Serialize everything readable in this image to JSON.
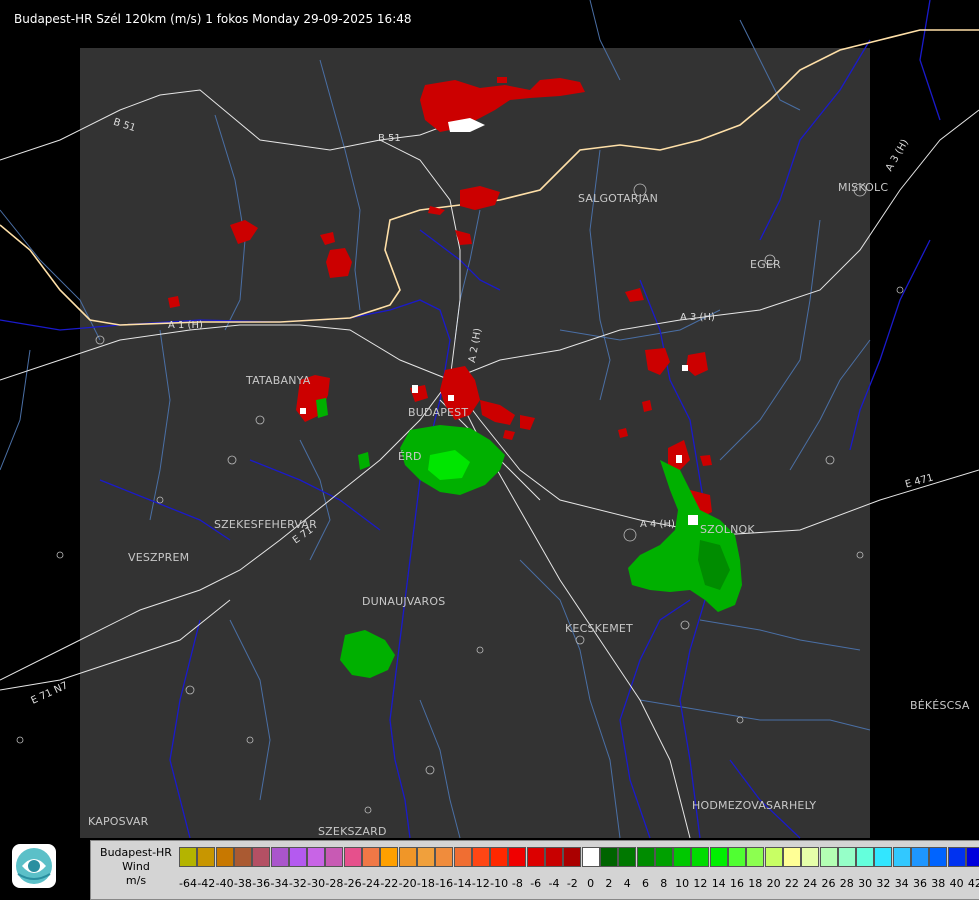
{
  "header": {
    "title": "Budapest-HR Szél 120km (m/s) 1 fokos Monday 29-09-2025 16:48"
  },
  "cities": [
    {
      "id": "salgotarjan",
      "name": "SALGOTARJAN"
    },
    {
      "id": "eger",
      "name": "EGER"
    },
    {
      "id": "miskolc",
      "name": "MISKOLC"
    },
    {
      "id": "tatabanya",
      "name": "TATABANYA"
    },
    {
      "id": "budapest",
      "name": "BUDAPEST"
    },
    {
      "id": "ero",
      "name": "ÉRD"
    },
    {
      "id": "szekesfehervar",
      "name": "SZEKESFEHERVAR"
    },
    {
      "id": "veszprem",
      "name": "VESZPREM"
    },
    {
      "id": "dunaujvaros",
      "name": "DUNAUJVAROS"
    },
    {
      "id": "kecskemet",
      "name": "KECSKEMET"
    },
    {
      "id": "szolnok",
      "name": "SZOLNOK"
    },
    {
      "id": "bekescsaba",
      "name": "BÉKÉSCSA"
    },
    {
      "id": "hodmezovasarhely",
      "name": "HODMEZOVASARHELY"
    },
    {
      "id": "kaposvar",
      "name": "KAPOSVAR"
    },
    {
      "id": "szekszard",
      "name": "SZEKSZARD"
    }
  ],
  "roads": [
    {
      "id": "b51-west",
      "name": "B 51"
    },
    {
      "id": "b51-east",
      "name": "B 51"
    },
    {
      "id": "a3-north",
      "name": "A 3 (H)"
    },
    {
      "id": "a3",
      "name": "A 3 (H)"
    },
    {
      "id": "a2",
      "name": "A 2 (H)"
    },
    {
      "id": "a1",
      "name": "A 1 (H)"
    },
    {
      "id": "a4",
      "name": "A 4 (H)"
    },
    {
      "id": "e71",
      "name": "E 71"
    },
    {
      "id": "e71-sw",
      "name": "E 71 N7"
    },
    {
      "id": "e471",
      "name": "E 471"
    }
  ],
  "legend": {
    "title_lines": [
      "Budapest-HR",
      "Wind",
      "m/s"
    ],
    "scale": [
      {
        "value": "-64",
        "color": "#b4b400"
      },
      {
        "value": "-42",
        "color": "#c89600"
      },
      {
        "value": "-40",
        "color": "#c87800"
      },
      {
        "value": "-38",
        "color": "#aa5a32"
      },
      {
        "value": "-36",
        "color": "#b45064"
      },
      {
        "value": "-34",
        "color": "#aa55cc"
      },
      {
        "value": "-32",
        "color": "#b45af0"
      },
      {
        "value": "-30",
        "color": "#c864e6"
      },
      {
        "value": "-28",
        "color": "#c85ab4"
      },
      {
        "value": "-26",
        "color": "#e6508c"
      },
      {
        "value": "-24",
        "color": "#f07846"
      },
      {
        "value": "-22",
        "color": "#ffa000"
      },
      {
        "value": "-20",
        "color": "#f09628"
      },
      {
        "value": "-18",
        "color": "#f0a03c"
      },
      {
        "value": "-16",
        "color": "#f08c3c"
      },
      {
        "value": "-14",
        "color": "#f06e32"
      },
      {
        "value": "-12",
        "color": "#ff4614"
      },
      {
        "value": "-10",
        "color": "#ff2800"
      },
      {
        "value": "-8",
        "color": "#f00000"
      },
      {
        "value": "-6",
        "color": "#dc0000"
      },
      {
        "value": "-4",
        "color": "#c80000"
      },
      {
        "value": "-2",
        "color": "#aa0000"
      },
      {
        "value": "0",
        "color": "#ffffff"
      },
      {
        "value": "2",
        "color": "#006400"
      },
      {
        "value": "4",
        "color": "#007800"
      },
      {
        "value": "6",
        "color": "#008c00"
      },
      {
        "value": "8",
        "color": "#00a000"
      },
      {
        "value": "10",
        "color": "#00c800"
      },
      {
        "value": "12",
        "color": "#00dc00"
      },
      {
        "value": "14",
        "color": "#00f000"
      },
      {
        "value": "16",
        "color": "#50ff32"
      },
      {
        "value": "18",
        "color": "#8cff50"
      },
      {
        "value": "20",
        "color": "#c8ff64"
      },
      {
        "value": "22",
        "color": "#ffff96"
      },
      {
        "value": "24",
        "color": "#e6ffaa"
      },
      {
        "value": "26",
        "color": "#b4ffb4"
      },
      {
        "value": "28",
        "color": "#96ffc8"
      },
      {
        "value": "30",
        "color": "#64ffdc"
      },
      {
        "value": "32",
        "color": "#32e6ff"
      },
      {
        "value": "34",
        "color": "#32c8ff"
      },
      {
        "value": "36",
        "color": "#1e96ff"
      },
      {
        "value": "38",
        "color": "#0064ff"
      },
      {
        "value": "40",
        "color": "#0032f0"
      },
      {
        "value": "42",
        "color": "#0000dc"
      }
    ]
  },
  "colors": {
    "radar_area": "#333333",
    "background": "#000000",
    "river": "#1a1acc",
    "county_border": "#4a6fa5",
    "national_border": "#ffe0a8",
    "road": "#e6e6e6",
    "echo_negative": "#cc0000",
    "echo_positive": "#00b000"
  },
  "logo": {
    "icon": "radar-logo-icon"
  }
}
